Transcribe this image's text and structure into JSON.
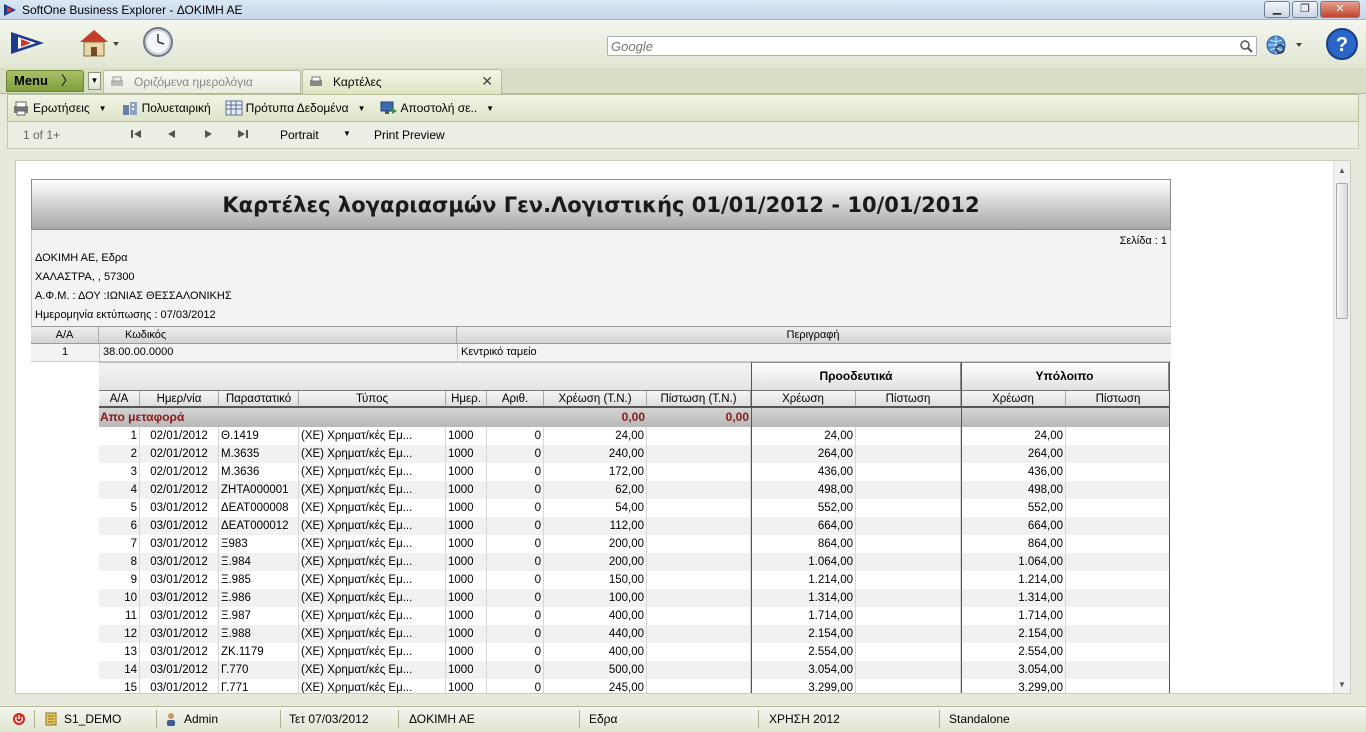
{
  "window": {
    "title": "SoftOne Business Explorer - ΔΟΚΙΜΗ ΑΕ",
    "minimize": "▁",
    "maximize": "❐",
    "close": "✕"
  },
  "search": {
    "placeholder": "Google"
  },
  "tabs": {
    "menu_label": "Menu",
    "menu_chevron": "〉",
    "dropdown": "▼",
    "items": [
      {
        "label": "Οριζόμενα ημερολόγια"
      },
      {
        "label": "Καρτέλες",
        "close": "✕"
      }
    ]
  },
  "actions": {
    "queries": "Ερωτήσεις",
    "multicompany": "Πολυεταιρική",
    "templates": "Πρότυπα Δεδομένα",
    "send": "Αποστολή σε..",
    "drop": "▼"
  },
  "nav": {
    "page_info": "1 of 1+",
    "orientation": "Portrait",
    "print_preview": "Print Preview",
    "drop": "▼"
  },
  "report": {
    "title": "Καρτέλες λογαριασμών Γεν.Λογιστικής 01/01/2012 - 10/01/2012",
    "page": "Σελίδα : 1",
    "company": "ΔΟΚΙΜΗ ΑΕ, Εδρα",
    "address": "ΧΑΛΑΣΤΡΑ, , 57300",
    "tax": "Α.Φ.Μ. : ΔΟΥ :ΙΩΝΙΑΣ ΘΕΣΣΑΛΟΝΙΚΗΣ",
    "print_date": "Ημερομηνία εκτύπωσης : 07/03/2012",
    "account_headers": {
      "aa": "Α/Α",
      "code": "Κωδικός",
      "description": "Περιγραφή"
    },
    "account": {
      "aa": "1",
      "code": "38.00.00.0000",
      "description": "Κεντρικό ταμείο"
    },
    "group_headers": {
      "progressive": "Προοδευτικά",
      "balance": "Υπόλοιπο"
    },
    "columns": [
      "Α/Α",
      "Ημερ/νία",
      "Παραστατικό",
      "Τύπος",
      "Ημερ.",
      "Αριθ.",
      "Χρέωση (Τ.Ν.)",
      "Πίστωση (Τ.Ν.)",
      "Χρέωση",
      "Πίστωση",
      "Χρέωση",
      "Πίστωση"
    ],
    "transfer": {
      "label": "Απο μεταφορά",
      "debit": "0,00",
      "credit": "0,00"
    },
    "rows": [
      [
        "1",
        "02/01/2012",
        "Θ.1419",
        "(ΧΕ) Χρηματ/κές Εμ...",
        "1000",
        "0",
        "24,00",
        "",
        "24,00",
        "",
        "24,00",
        ""
      ],
      [
        "2",
        "02/01/2012",
        "Μ.3635",
        "(ΧΕ) Χρηματ/κές Εμ...",
        "1000",
        "0",
        "240,00",
        "",
        "264,00",
        "",
        "264,00",
        ""
      ],
      [
        "3",
        "02/01/2012",
        "Μ.3636",
        "(ΧΕ) Χρηματ/κές Εμ...",
        "1000",
        "0",
        "172,00",
        "",
        "436,00",
        "",
        "436,00",
        ""
      ],
      [
        "4",
        "02/01/2012",
        "ΖΗΤΑ000001",
        "(ΧΕ) Χρηματ/κές Εμ...",
        "1000",
        "0",
        "62,00",
        "",
        "498,00",
        "",
        "498,00",
        ""
      ],
      [
        "5",
        "03/01/2012",
        "ΔΕΑΤ000008",
        "(ΧΕ) Χρηματ/κές Εμ...",
        "1000",
        "0",
        "54,00",
        "",
        "552,00",
        "",
        "552,00",
        ""
      ],
      [
        "6",
        "03/01/2012",
        "ΔΕΑΤ000012",
        "(ΧΕ) Χρηματ/κές Εμ...",
        "1000",
        "0",
        "112,00",
        "",
        "664,00",
        "",
        "664,00",
        ""
      ],
      [
        "7",
        "03/01/2012",
        "Ξ983",
        "(ΧΕ) Χρηματ/κές Εμ...",
        "1000",
        "0",
        "200,00",
        "",
        "864,00",
        "",
        "864,00",
        ""
      ],
      [
        "8",
        "03/01/2012",
        "Ξ.984",
        "(ΧΕ) Χρηματ/κές Εμ...",
        "1000",
        "0",
        "200,00",
        "",
        "1.064,00",
        "",
        "1.064,00",
        ""
      ],
      [
        "9",
        "03/01/2012",
        "Ξ.985",
        "(ΧΕ) Χρηματ/κές Εμ...",
        "1000",
        "0",
        "150,00",
        "",
        "1.214,00",
        "",
        "1.214,00",
        ""
      ],
      [
        "10",
        "03/01/2012",
        "Ξ.986",
        "(ΧΕ) Χρηματ/κές Εμ...",
        "1000",
        "0",
        "100,00",
        "",
        "1.314,00",
        "",
        "1.314,00",
        ""
      ],
      [
        "11",
        "03/01/2012",
        "Ξ.987",
        "(ΧΕ) Χρηματ/κές Εμ...",
        "1000",
        "0",
        "400,00",
        "",
        "1.714,00",
        "",
        "1.714,00",
        ""
      ],
      [
        "12",
        "03/01/2012",
        "Ξ.988",
        "(ΧΕ) Χρηματ/κές Εμ...",
        "1000",
        "0",
        "440,00",
        "",
        "2.154,00",
        "",
        "2.154,00",
        ""
      ],
      [
        "13",
        "03/01/2012",
        "ΖΚ.1179",
        "(ΧΕ) Χρηματ/κές Εμ...",
        "1000",
        "0",
        "400,00",
        "",
        "2.554,00",
        "",
        "2.554,00",
        ""
      ],
      [
        "14",
        "03/01/2012",
        "Γ.770",
        "(ΧΕ) Χρηματ/κές Εμ...",
        "1000",
        "0",
        "500,00",
        "",
        "3.054,00",
        "",
        "3.054,00",
        ""
      ],
      [
        "15",
        "03/01/2012",
        "Γ.771",
        "(ΧΕ) Χρηματ/κές Εμ...",
        "1000",
        "0",
        "245,00",
        "",
        "3.299,00",
        "",
        "3.299,00",
        ""
      ]
    ]
  },
  "statusbar": {
    "database": "S1_DEMO",
    "user": "Admin",
    "date": "Τετ 07/03/2012",
    "company": "ΔΟΚΙΜΗ ΑΕ",
    "branch": "Εδρα",
    "fiscal_year": "ΧΡΗΣΗ 2012",
    "mode": "Standalone"
  },
  "colors": {
    "accent_green": "#8aa848",
    "transfer_red": "#8b1a1a",
    "title_gradient": "#a9a9a9"
  }
}
